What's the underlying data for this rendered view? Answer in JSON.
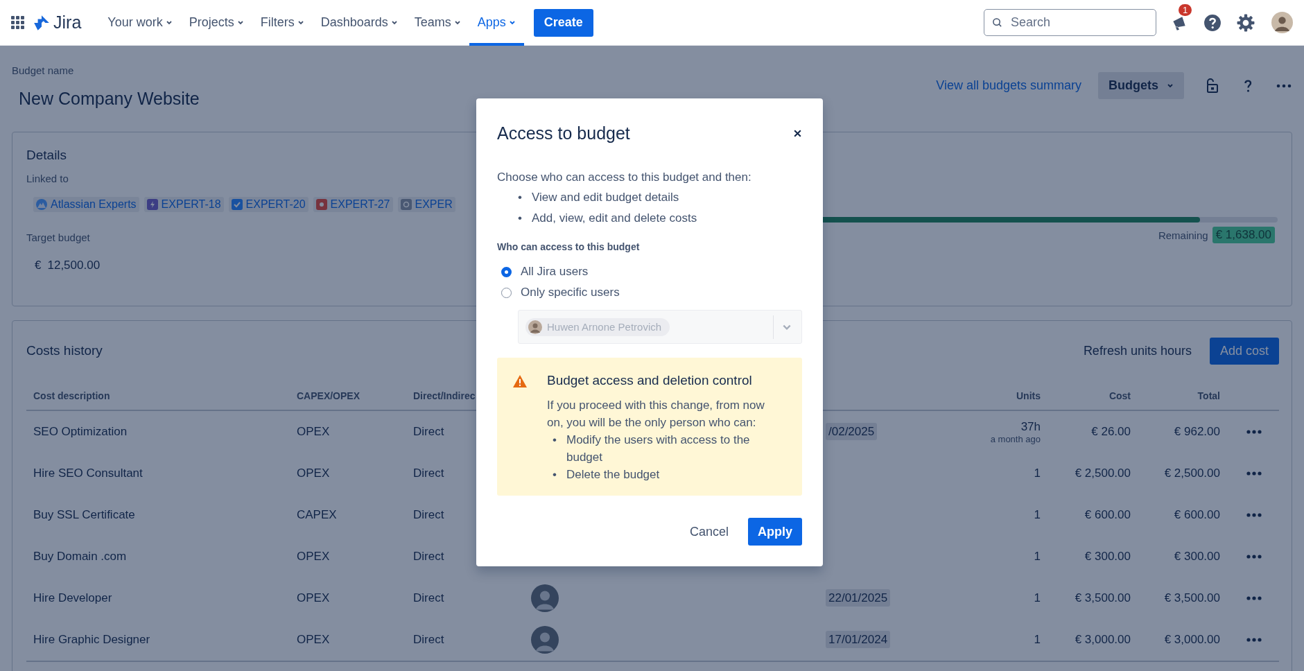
{
  "top_nav": {
    "product": "Jira",
    "items": [
      {
        "label": "Your work",
        "selected": false
      },
      {
        "label": "Projects",
        "selected": false
      },
      {
        "label": "Filters",
        "selected": false
      },
      {
        "label": "Dashboards",
        "selected": false
      },
      {
        "label": "Teams",
        "selected": false
      },
      {
        "label": "Apps",
        "selected": true
      }
    ],
    "create_button": "Create",
    "search": {
      "placeholder": "Search"
    },
    "notification_count": "1"
  },
  "page": {
    "label": "Budget name",
    "title": "New Company Website",
    "summary_link": "View all budgets summary",
    "budgets_button": "Budgets"
  },
  "details": {
    "title": "Details",
    "linked_label": "Linked to",
    "links": [
      {
        "label": "Atlassian Experts",
        "kind": "project"
      },
      {
        "label": "EXPERT-18",
        "kind": "epic"
      },
      {
        "label": "EXPERT-20",
        "kind": "task"
      },
      {
        "label": "EXPERT-27",
        "kind": "bug"
      },
      {
        "label": "EXPER",
        "kind": "other"
      }
    ],
    "target_label": "Target budget",
    "target_currency": "€",
    "target_value": "12,500.00",
    "progress": {
      "level": 0.87
    },
    "remaining_label": "Remaining",
    "remaining_value": "€ 1,638.00"
  },
  "costs": {
    "title": "Costs history",
    "refresh_button": "Refresh units hours",
    "add_button": "Add cost",
    "columns": [
      "Cost description",
      "CAPEX/OPEX",
      "Direct/Indirec",
      "Units",
      "Cost",
      "Total"
    ],
    "rows": [
      {
        "description": "SEO Optimization",
        "type": "OPEX",
        "direct": "Direct",
        "avatar": false,
        "date": "/02/2025",
        "units": "37h",
        "units_note": "a month ago",
        "cost": "€ 26.00",
        "total": "€ 962.00"
      },
      {
        "description": "Hire SEO Consultant",
        "type": "OPEX",
        "direct": "Direct",
        "avatar": false,
        "units": "1",
        "cost": "€ 2,500.00",
        "total": "€ 2,500.00"
      },
      {
        "description": "Buy SSL Certificate",
        "type": "CAPEX",
        "direct": "Direct",
        "avatar": false,
        "units": "1",
        "cost": "€ 600.00",
        "total": "€ 600.00"
      },
      {
        "description": "Buy Domain .com",
        "type": "OPEX",
        "direct": "Direct",
        "avatar": false,
        "units": "1",
        "cost": "€ 300.00",
        "total": "€ 300.00"
      },
      {
        "description": "Hire Developer",
        "type": "OPEX",
        "direct": "Direct",
        "avatar": true,
        "date": "22/01/2025",
        "units": "1",
        "cost": "€ 3,500.00",
        "total": "€ 3,500.00"
      },
      {
        "description": "Hire Graphic Designer",
        "type": "OPEX",
        "direct": "Direct",
        "avatar": true,
        "date": "17/01/2024",
        "units": "1",
        "cost": "€ 3,000.00",
        "total": "€ 3,000.00"
      }
    ]
  },
  "dialog": {
    "title": "Access to budget",
    "intro": "Choose who can access to this budget and then:",
    "intro_points": [
      {
        "marker": "•",
        "text": "View and edit budget details"
      },
      {
        "marker": "•",
        "text": "Add, view, edit and delete costs"
      }
    ],
    "access_label": "Who can access to this budget",
    "options": [
      {
        "label": "All Jira users",
        "selected": true
      },
      {
        "label": "Only specific users",
        "selected": false
      }
    ],
    "user_select": {
      "disabled": true,
      "users": [
        "Huwen Arnone Petrovich"
      ]
    },
    "warning": {
      "title": "Budget access and deletion control",
      "text": "If you proceed with this change, from now on, you will be the only person who can:",
      "points": [
        {
          "marker": "•",
          "text": "Modify the users with access to the budget"
        },
        {
          "marker": "•",
          "text": "Delete the budget"
        }
      ]
    },
    "buttons": [
      {
        "label": "Cancel",
        "kind": "subtle"
      },
      {
        "label": "Apply",
        "kind": "primary"
      }
    ]
  }
}
